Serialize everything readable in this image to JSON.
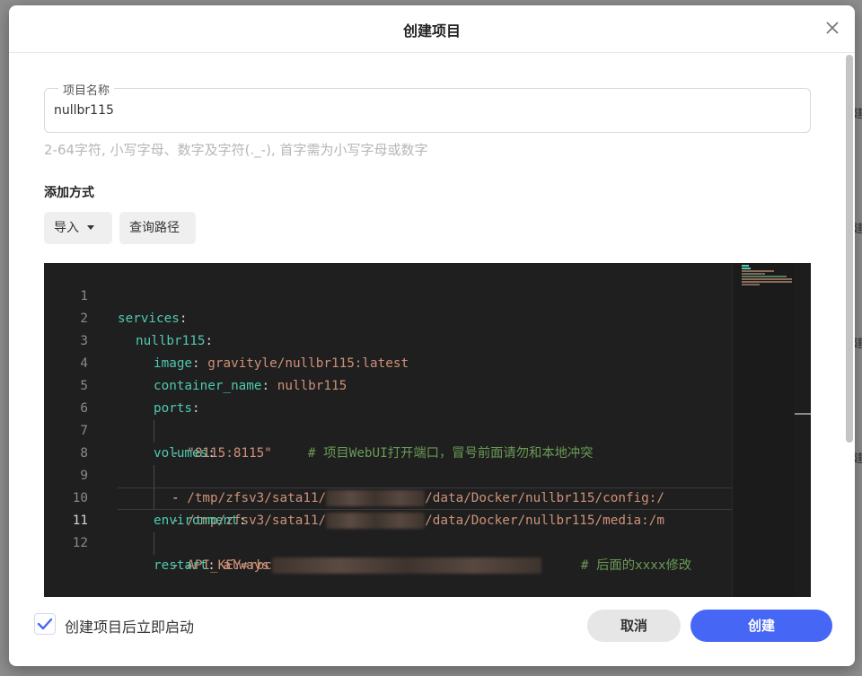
{
  "dialog": {
    "title": "创建项目",
    "name_field": {
      "legend": "项目名称",
      "value": "nullbr115"
    },
    "hint": "2-64字符, 小写字母、数字及字符(._-), 首字需为小写字母或数字",
    "section_label": "添加方式",
    "import_button": "导入",
    "query_path_button": "查询路径",
    "autostart_label": "创建项目后立即启动",
    "autostart_checked": true,
    "cancel_button": "取消",
    "create_button": "创建"
  },
  "editor": {
    "current_line": 11,
    "lines": [
      {
        "n": "1",
        "key": "services",
        "colon": ":"
      },
      {
        "n": "2",
        "key": "nullbr115",
        "colon": ":"
      },
      {
        "n": "3",
        "key": "image",
        "colon": ": ",
        "val": "gravityle/nullbr115:latest"
      },
      {
        "n": "4",
        "key": "container_name",
        "colon": ": ",
        "val": "nullbr115"
      },
      {
        "n": "5",
        "key": "ports",
        "colon": ":"
      },
      {
        "n": "6",
        "dash": "- ",
        "val": "\"8115:8115\"",
        "comment": "# 项目WebUI打开端口，冒号前面请勿和本地冲突"
      },
      {
        "n": "7",
        "key": "volumes",
        "colon": ":"
      },
      {
        "n": "8",
        "dash": "- ",
        "val": "/tmp/zfsv3/sata11/",
        "val2": "/data/Docker/nullbr115/config:/"
      },
      {
        "n": "9",
        "dash": "- ",
        "val": "/tmp/zfsv3/sata11/",
        "val2": "/data/Docker/nullbr115/media:/m"
      },
      {
        "n": "10",
        "key": "environment",
        "colon": ":"
      },
      {
        "n": "11",
        "dash": "- ",
        "val": "API_KEY=rbc",
        "comment": "# 后面的xxxx修改"
      },
      {
        "n": "12",
        "key": "restart",
        "colon": ": ",
        "val": "always"
      }
    ]
  },
  "colors": {
    "accent": "#4667f5",
    "editor_bg": "#1f1f1f",
    "key": "#4ec9b0",
    "string": "#ce9178",
    "comment": "#6a9955"
  },
  "backdrop": {
    "edge_glyphs": [
      "建",
      "建",
      "建",
      "建"
    ]
  }
}
